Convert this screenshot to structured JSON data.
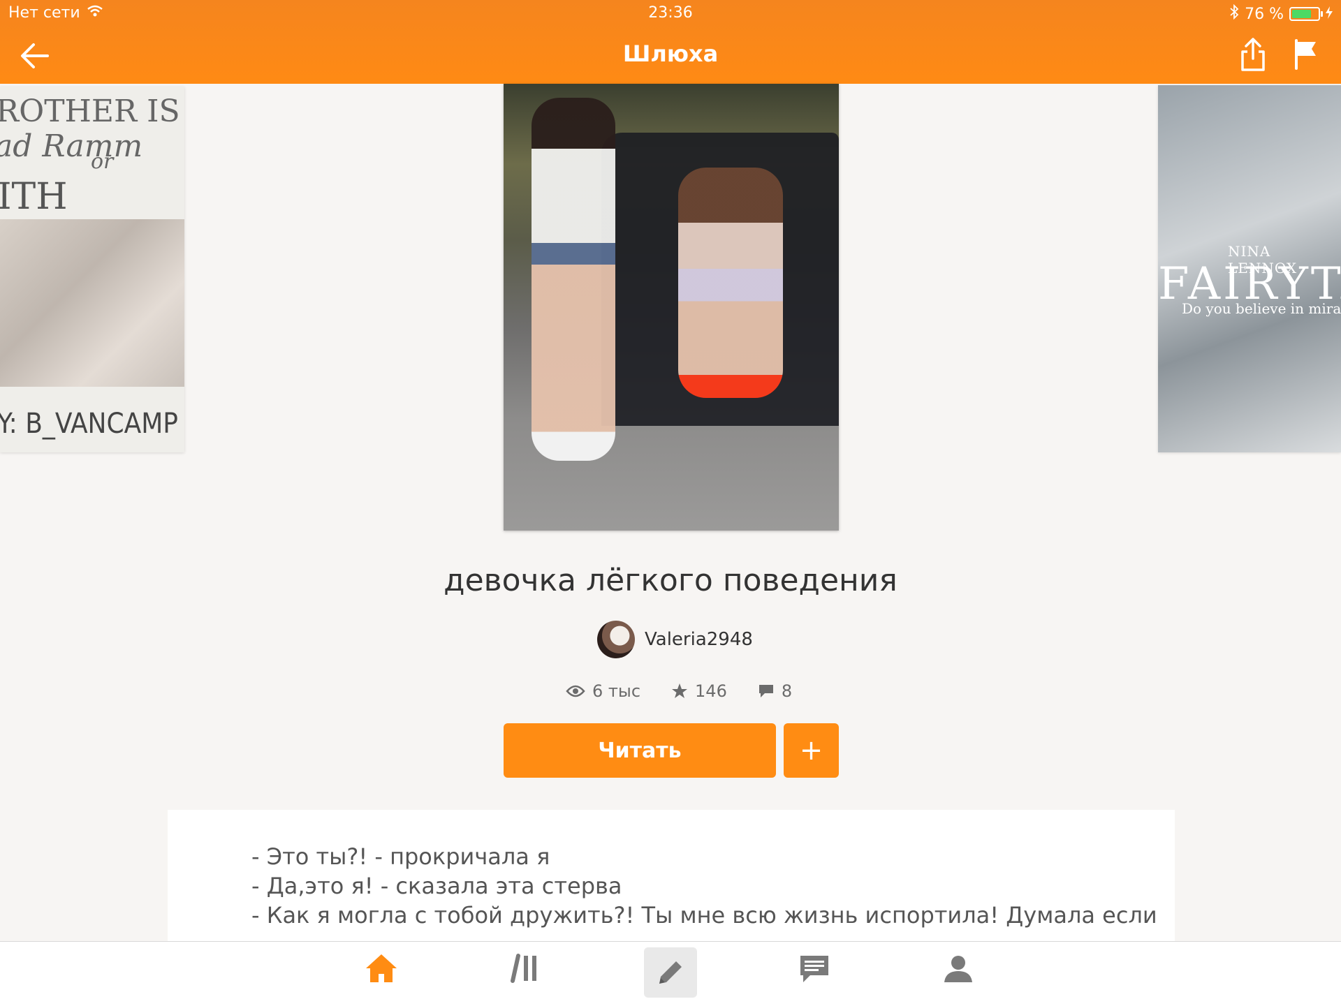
{
  "status_bar": {
    "carrier": "Нет сети",
    "time": "23:36",
    "battery": "76 %",
    "battery_level": 0.76
  },
  "nav": {
    "title": "Шлюха"
  },
  "covers": {
    "left": {
      "line1": "ROTHER IS",
      "line2": "ad Ramm",
      "line2b": "or",
      "line3": "ITH MBAND",
      "line4": "Y: B_VANCAMP"
    },
    "right": {
      "author": "NINA LENNOX",
      "title": "FAIRYTA",
      "tagline": "Do you believe in mirac"
    }
  },
  "book": {
    "title": "девочка лёгкого поведения",
    "author": "Valeria2948",
    "stats": {
      "views": "6 тыс",
      "votes": "146",
      "comments": "8"
    }
  },
  "actions": {
    "read_label": "Читать",
    "add_label": "+"
  },
  "excerpt": {
    "lines": [
      "- Это ты?! - прокричала я",
      "- Да,это я! - сказала эта стерва",
      "- Как я могла с тобой дружить?! Ты мне всю жизнь испортила! Думала если"
    ]
  },
  "tabs": [
    "home",
    "library",
    "write",
    "messages",
    "profile"
  ],
  "colors": {
    "accent": "#ff8c13",
    "topbar": "#f7861c",
    "background": "#f7f5f3"
  }
}
